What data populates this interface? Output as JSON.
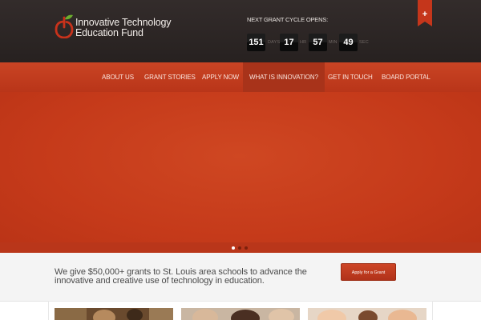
{
  "brand": {
    "line1": "Innovative Technology",
    "line2": "Education Fund"
  },
  "countdown": {
    "label": "NEXT GRANT CYCLE OPENS:",
    "items": [
      {
        "value": "151",
        "unit": "DAYS"
      },
      {
        "value": "17",
        "unit": "HR"
      },
      {
        "value": "57",
        "unit": "MIN"
      },
      {
        "value": "49",
        "unit": "SEC"
      }
    ]
  },
  "ribbon": {
    "icon": "plus-icon",
    "symbol": "+"
  },
  "nav": {
    "items": [
      {
        "label": "ABOUT US"
      },
      {
        "label": "GRANT STORIES"
      },
      {
        "label": "APPLY NOW"
      },
      {
        "label": "WHAT IS INNOVATION?"
      },
      {
        "label": "GET IN TOUCH"
      },
      {
        "label": "BOARD PORTAL"
      }
    ],
    "active_index": 3
  },
  "slider": {
    "dots": 3,
    "active_dot": 0
  },
  "callout": {
    "text": "We give $50,000+ grants to St. Louis area schools to advance the innovative and creative use of technology in education.",
    "button": "Apply for a Grant"
  },
  "thumbnails": [
    {
      "icon": "classroom-photo-icon"
    },
    {
      "icon": "students-photo-icon"
    },
    {
      "icon": "children-photo-icon"
    }
  ],
  "colors": {
    "header_bg": "#2d2726",
    "accent": "#c23a1e",
    "callout_bg": "#f4f4f4"
  }
}
